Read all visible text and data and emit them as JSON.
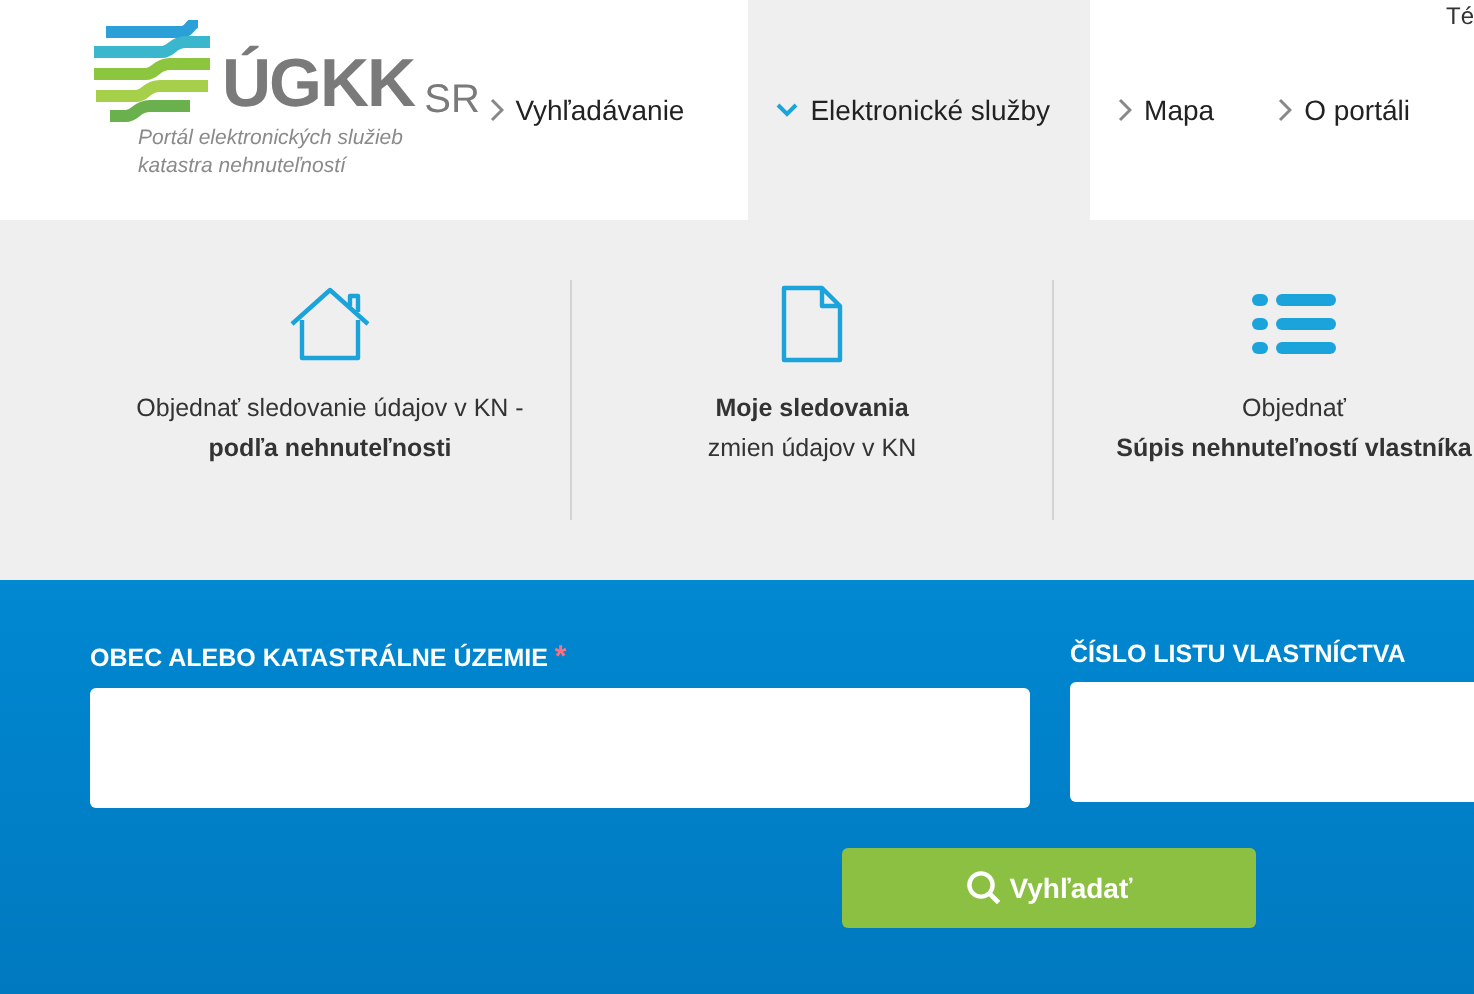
{
  "header": {
    "logo": {
      "name": "ÚGKK",
      "suffix": "SR",
      "tagline": [
        "Portál elektronických služieb",
        "katastra nehnuteľností"
      ]
    },
    "top_link": "Té",
    "nav": [
      {
        "label": "Vyhľadávanie",
        "selected": false
      },
      {
        "label": "Elektronické služby",
        "selected": true
      },
      {
        "label": "Mapa",
        "selected": false
      },
      {
        "label": "O portáli",
        "selected": false
      }
    ]
  },
  "services_menu": [
    {
      "kind": "house",
      "lines": [
        {
          "text": "Objednať sledovanie údajov v KN -",
          "bold": false
        },
        {
          "text": "podľa nehnuteľnosti",
          "bold": true
        }
      ]
    },
    {
      "kind": "document",
      "lines": [
        {
          "text": "Moje sledovania",
          "bold": true
        },
        {
          "text": "zmien údajov v KN",
          "bold": false
        }
      ]
    },
    {
      "kind": "list",
      "lines": [
        {
          "text": "Objednať",
          "bold": false
        },
        {
          "text": "Súpis nehnuteľností vlastníka",
          "bold": true
        }
      ]
    }
  ],
  "search_form": {
    "fields": [
      {
        "label": "OBEC ALEBO KATASTRÁLNE ÚZEMIE",
        "required": true
      },
      {
        "label": "ČÍSLO LISTU VLASTNÍCTVA",
        "required": false
      }
    ],
    "required_mark": "*",
    "button": "Vyhľadať"
  }
}
